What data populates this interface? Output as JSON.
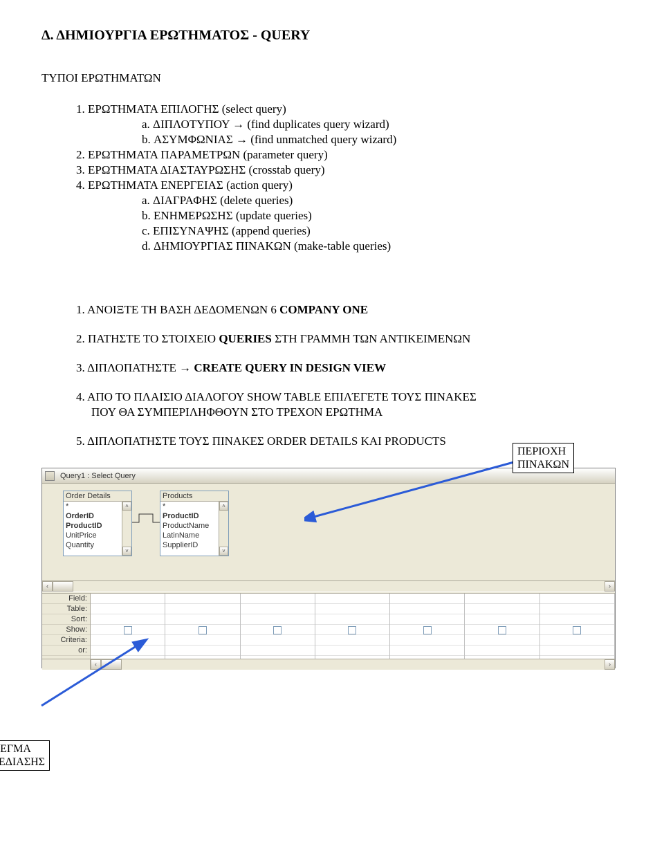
{
  "title": "Δ. ΔΗΜΙΟΥΡΓΙΑ ΕΡΩΤΗΜΑΤΟΣ  - QUERY",
  "subtitle": "ΤΥΠΟΙ ΕΡΩΤΗΜΑΤΩΝ",
  "types": {
    "i1": "1.  ΕΡΩΤΗΜΑΤΑ ΕΠΙΛΟΓΗΣ (select query)",
    "i1a": "a.  ΔΙΠΛΟΤΥΠΟΥ → (find duplicates query wizard)",
    "i1b": "b.  ΑΣΥΜΦΩΝΙΑΣ → (find unmatched query wizard)",
    "i2": "2.  ΕΡΩΤΗΜΑΤΑ ΠΑΡΑΜΕΤΡΩΝ (parameter query)",
    "i3": "3.  ΕΡΩΤΗΜΑΤΑ ΔΙΑΣΤΑΥΡΩΣΗΣ (crosstab query)",
    "i4": "4.  ΕΡΩΤΗΜΑΤΑ ΕΝΕΡΓΕΙΑΣ (action query)",
    "i4a": "a.  ΔΙΑΓΡΑΦΗΣ (delete queries)",
    "i4b": "b.  ΕΝΗΜΕΡΩΣΗΣ (update queries)",
    "i4c": "c.  ΕΠΙΣΥΝΑΨΗΣ (append queries)",
    "i4d": "d.  ΔΗΜΙΟΥΡΓΙΑΣ ΠΙΝΑΚΩΝ (make-table queries)"
  },
  "steps": {
    "s1a": "1.  ΑΝΟΙΞΤΕ ΤΗ ΒΑΣΗ ΔΕΔΟΜΕΝΩΝ 6 ",
    "s1b": "COMPANY ONE",
    "s2a": "2.  ΠΑΤΗΣΤΕ ΤΟ ΣΤΟΙΧΕΙΟ ",
    "s2b": "QUERIES",
    "s2c": " ΣΤΗ ΓΡΑΜΜΗ ΤΩΝ ΑΝΤΙΚΕΙΜΕΝΩΝ",
    "s3a": "3.  ΔΙΠΛΟΠΑΤΗΣΤΕ → ",
    "s3b": "CREATE QUERY IN DESIGN VIEW",
    "s4a": "4.  ΑΠΟ ΤΟ ΠΛΑΙΣΙΟ ΔΙΑΛΟΓΟΥ SHOW TABLE ΕΠΙΛΈΓΕΤΕ ΤΟΥΣ ΠΙΝΑΚΕΣ",
    "s4b": "ΠΟΥ ΘΑ ΣΥΜΠΕΡΙΛΗΦΘΟΥΝ ΣΤΟ ΤΡΕΧΟΝ ΕΡΩΤΗΜΑ",
    "s5": "5.  ΔΙΠΛΟΠΑΤΗΣΤΕ ΤΟΥΣ ΠΙΝΑΚΕΣ ORDER DETAILS KAI PRODUCTS"
  },
  "callout": {
    "top1": "ΠΕΡΙΟΧΗ",
    "top2": "ΠΙΝΑΚΩΝ",
    "bot1": "ΠΛΕΓΜΑ",
    "bot2": "ΣΧΕΔΙΑΣΗΣ"
  },
  "qwindow": {
    "title": "Query1 : Select Query",
    "table1": {
      "name": "Order Details",
      "rows": [
        "*",
        "OrderID",
        "ProductID",
        "UnitPrice",
        "Quantity"
      ],
      "bold": [
        "OrderID",
        "ProductID"
      ]
    },
    "table2": {
      "name": "Products",
      "rows": [
        "*",
        "ProductID",
        "ProductName",
        "LatinName",
        "SupplierID"
      ],
      "bold": [
        "ProductID"
      ]
    },
    "gridLabels": [
      "Field:",
      "Table:",
      "Sort:",
      "Show:",
      "Criteria:",
      "or:"
    ]
  }
}
